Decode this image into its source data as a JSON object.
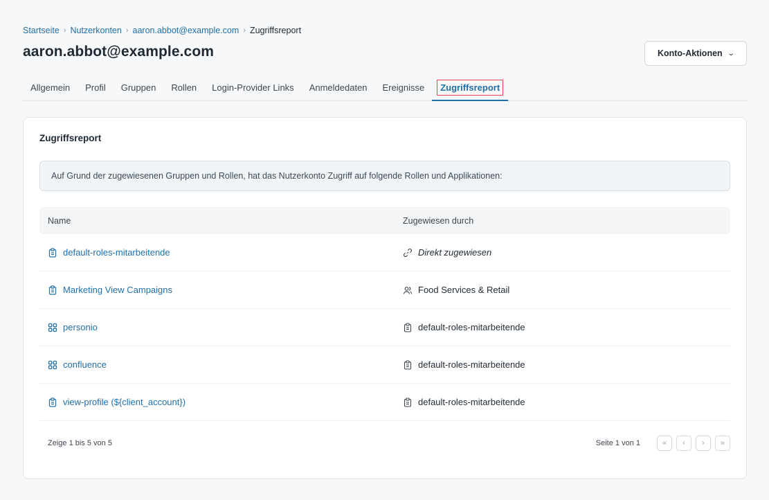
{
  "breadcrumb": {
    "items": [
      "Startseite",
      "Nutzerkonten",
      "aaron.abbot@example.com"
    ],
    "current": "Zugriffsreport"
  },
  "page": {
    "title": "aaron.abbot@example.com",
    "actions_label": "Konto-Aktionen"
  },
  "tabs": [
    {
      "label": "Allgemein"
    },
    {
      "label": "Profil"
    },
    {
      "label": "Gruppen"
    },
    {
      "label": "Rollen"
    },
    {
      "label": "Login-Provider Links"
    },
    {
      "label": "Anmeldedaten"
    },
    {
      "label": "Ereignisse"
    },
    {
      "label": "Zugriffsreport",
      "active": true
    }
  ],
  "report": {
    "title": "Zugriffsreport",
    "info": "Auf Grund der zugewiesenen Gruppen und Rollen, hat das Nutzerkonto Zugriff auf folgende Rollen und Applikationen:",
    "columns": {
      "name": "Name",
      "assigned_by": "Zugewiesen durch"
    },
    "rows": [
      {
        "name": "default-roles-mitarbeitende",
        "name_icon": "clipboard-icon",
        "assigned_by": "Direkt zugewiesen",
        "by_icon": "link-icon"
      },
      {
        "name": "Marketing View Campaigns",
        "name_icon": "clipboard-icon",
        "assigned_by": "Food Services & Retail",
        "by_icon": "users-icon"
      },
      {
        "name": "personio",
        "name_icon": "apps-grid-icon",
        "assigned_by": "default-roles-mitarbeitende",
        "by_icon": "clipboard-icon"
      },
      {
        "name": "confluence",
        "name_icon": "apps-grid-icon",
        "assigned_by": "default-roles-mitarbeitende",
        "by_icon": "clipboard-icon"
      },
      {
        "name": "view-profile (${client_account})",
        "name_icon": "clipboard-icon",
        "assigned_by": "default-roles-mitarbeitende",
        "by_icon": "clipboard-icon"
      }
    ],
    "footer": {
      "summary": "Zeige 1 bis 5 von 5",
      "page_info": "Seite 1 von 1"
    }
  },
  "colors": {
    "accent": "#1f6fa8",
    "highlight": "#e0474c"
  }
}
